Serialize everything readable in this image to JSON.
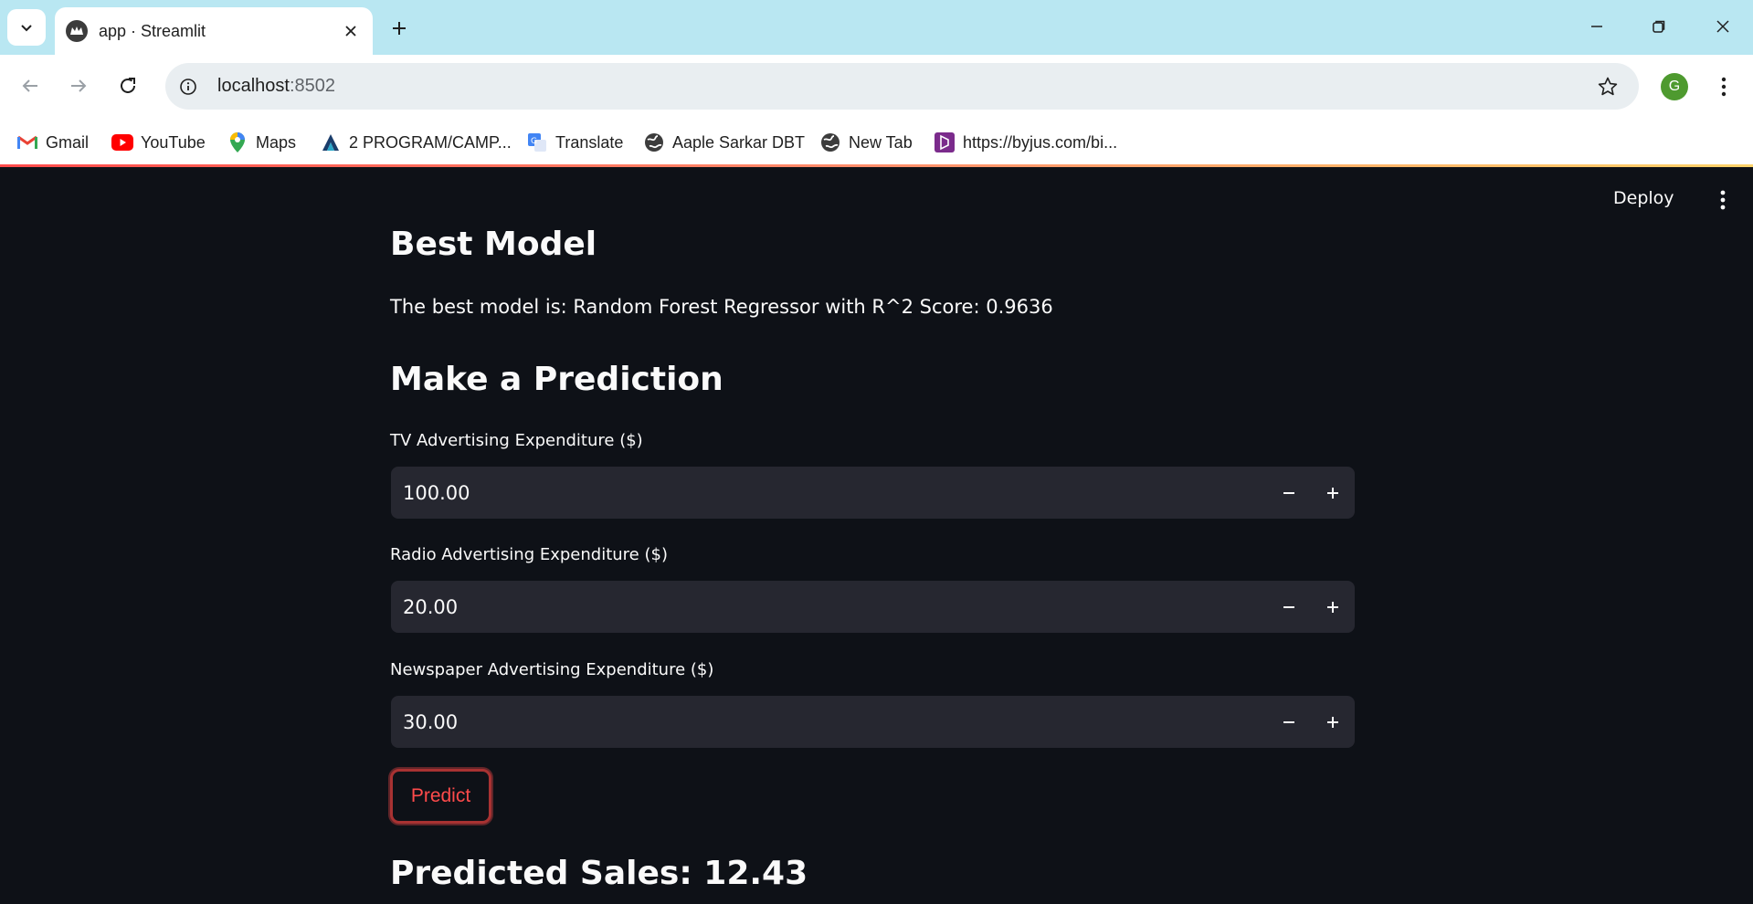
{
  "browser": {
    "tab_title": "app · Streamlit",
    "url_host": "localhost",
    "url_port": ":8502",
    "profile_initial": "G",
    "bookmarks": [
      {
        "label": "Gmail",
        "icon": "gmail-icon"
      },
      {
        "label": "YouTube",
        "icon": "youtube-icon"
      },
      {
        "label": "Maps",
        "icon": "maps-icon"
      },
      {
        "label": "2 PROGRAM/CAMP...",
        "icon": "program-icon"
      },
      {
        "label": "Translate",
        "icon": "translate-icon"
      },
      {
        "label": "Aaple Sarkar DBT",
        "icon": "globe-icon"
      },
      {
        "label": "New Tab",
        "icon": "globe-icon"
      },
      {
        "label": "https://byjus.com/bi...",
        "icon": "byjus-icon"
      }
    ]
  },
  "app": {
    "deploy_label": "Deploy",
    "best_model_heading": "Best Model",
    "best_model_text": "The best model is: Random Forest Regressor with R^2 Score: 0.9636",
    "prediction_heading": "Make a Prediction",
    "inputs": [
      {
        "label": "TV Advertising Expenditure ($)",
        "value": "100.00"
      },
      {
        "label": "Radio Advertising Expenditure ($)",
        "value": "20.00"
      },
      {
        "label": "Newspaper Advertising Expenditure ($)",
        "value": "30.00"
      }
    ],
    "predict_label": "Predict",
    "result_heading": "Predicted Sales: 12.43"
  },
  "colors": {
    "app_background": "#0e1117",
    "input_background": "#262730",
    "accent": "#ff4b4b",
    "tabstrip": "#b9e7f2"
  }
}
